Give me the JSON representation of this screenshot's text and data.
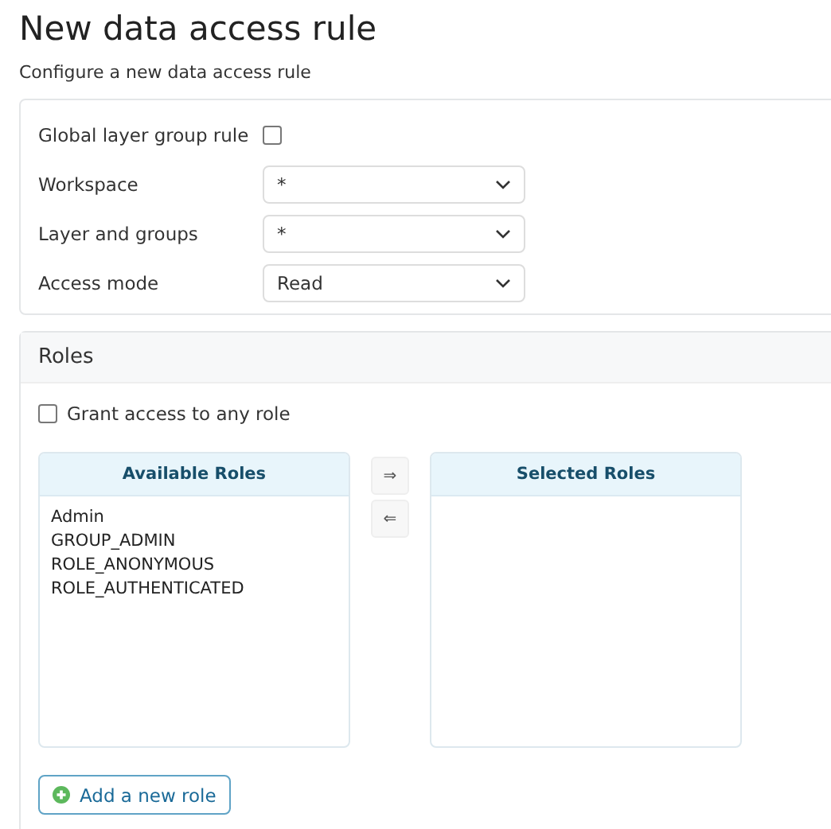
{
  "title": "New data access rule",
  "subtitle": "Configure a new data access rule",
  "form": {
    "fields": [
      {
        "kind": "checkbox",
        "label": "Global layer group rule",
        "checked": false
      },
      {
        "kind": "select",
        "label": "Workspace",
        "value": "*"
      },
      {
        "kind": "select",
        "label": "Layer and groups",
        "value": "*"
      },
      {
        "kind": "select",
        "label": "Access mode",
        "value": "Read"
      }
    ]
  },
  "roles": {
    "heading": "Roles",
    "grant_any": {
      "label": "Grant access to any role",
      "checked": false
    },
    "available": {
      "heading": "Available Roles",
      "items": [
        "Admin",
        "GROUP_ADMIN",
        "ROLE_ANONYMOUS",
        "ROLE_AUTHENTICATED"
      ]
    },
    "move_buttons": [
      "⇒",
      "⇐"
    ],
    "selected": {
      "heading": "Selected Roles"
    },
    "add_button": "Add a new role"
  }
}
